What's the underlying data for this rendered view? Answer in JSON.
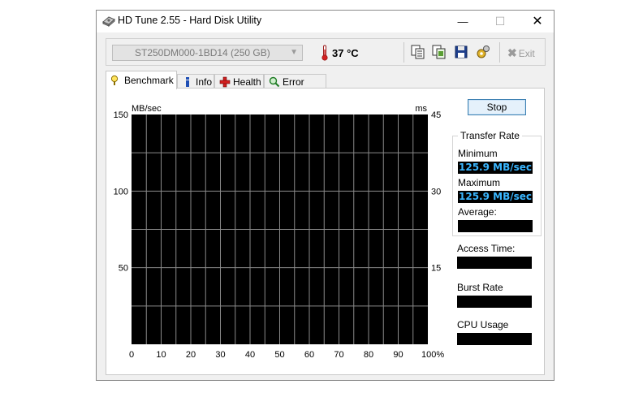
{
  "window": {
    "title": "HD Tune 2.55 - Hard Disk Utility",
    "controls": {
      "minimize": "—",
      "maximize": "☐",
      "close": "✕"
    }
  },
  "toolbar": {
    "drive": "ST250DM000-1BD14 (250 GB)",
    "temperature": "37 °C",
    "icons": [
      "copy-text-icon",
      "copy-screenshot-icon",
      "save-icon",
      "options-icon"
    ],
    "exit_label": "Exit"
  },
  "tabs": [
    {
      "label": "Benchmark",
      "icon": "benchmark-icon",
      "active": true
    },
    {
      "label": "Info",
      "icon": "info-icon",
      "active": false
    },
    {
      "label": "Health",
      "icon": "health-icon",
      "active": false
    },
    {
      "label": "Error Scan",
      "icon": "error-scan-icon",
      "active": false
    }
  ],
  "benchmark": {
    "stop_label": "Stop",
    "transfer_rate_title": "Transfer Rate",
    "minimum_label": "Minimum",
    "minimum_value": "125.9 MB/sec",
    "maximum_label": "Maximum",
    "maximum_value": "125.9 MB/sec",
    "average_label": "Average:",
    "average_value": "",
    "access_time_label": "Access Time:",
    "access_time_value": "",
    "burst_rate_label": "Burst Rate",
    "burst_rate_value": "",
    "cpu_usage_label": "CPU Usage",
    "cpu_usage_value": ""
  },
  "chart_data": {
    "type": "line",
    "ylabel_left": "MB/sec",
    "ylabel_right": "ms",
    "ylim_left": [
      0,
      150
    ],
    "ylim_right": [
      0,
      45
    ],
    "yticks_left": [
      "150",
      "100",
      "50"
    ],
    "yticks_right": [
      "45",
      "30",
      "15"
    ],
    "xlim": [
      0,
      100
    ],
    "xticks": [
      "0",
      "10",
      "20",
      "30",
      "40",
      "50",
      "60",
      "70",
      "80",
      "90",
      "100%"
    ],
    "grid": true,
    "series": []
  }
}
